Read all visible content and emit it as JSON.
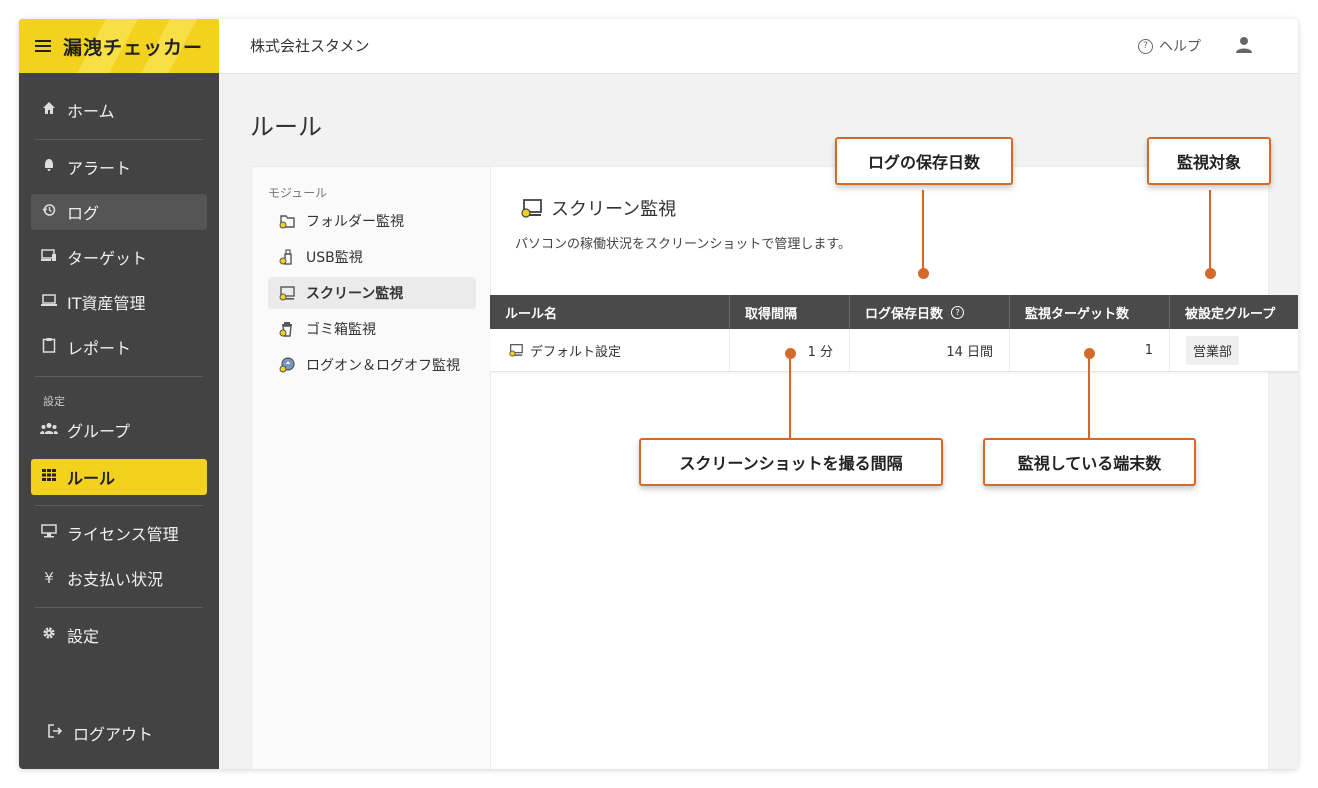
{
  "app": {
    "brand": "漏洩チェッカー",
    "company": "株式会社スタメン"
  },
  "header": {
    "help_label": "ヘルプ"
  },
  "sidebar": {
    "items": [
      {
        "label": "ホーム",
        "icon": "home-icon"
      },
      {
        "label": "アラート",
        "icon": "bell-icon"
      },
      {
        "label": "ログ",
        "icon": "history-icon"
      },
      {
        "label": "ターゲット",
        "icon": "devices-icon"
      },
      {
        "label": "IT資産管理",
        "icon": "laptop-icon"
      },
      {
        "label": "レポート",
        "icon": "clipboard-icon"
      }
    ],
    "section_label": "設定",
    "settings_items": [
      {
        "label": "グループ",
        "icon": "group-icon"
      },
      {
        "label": "ルール",
        "icon": "grid-icon"
      }
    ],
    "billing_items": [
      {
        "label": "ライセンス管理",
        "icon": "license-icon"
      },
      {
        "label": "お支払い状況",
        "icon": "yen-icon"
      }
    ],
    "config_label": "設定",
    "logout_label": "ログアウト"
  },
  "page": {
    "title": "ルール"
  },
  "modules": {
    "label": "モジュール",
    "items": [
      {
        "label": "フォルダー監視",
        "icon": "folder-watch-icon"
      },
      {
        "label": "USB監視",
        "icon": "usb-watch-icon"
      },
      {
        "label": "スクリーン監視",
        "icon": "screen-watch-icon",
        "selected": true
      },
      {
        "label": "ゴミ箱監視",
        "icon": "trash-watch-icon"
      },
      {
        "label": "ログオン＆ログオフ監視",
        "icon": "logon-watch-icon"
      }
    ]
  },
  "detail": {
    "title": "スクリーン監視",
    "description": "パソコンの稼働状況をスクリーンショットで管理します。",
    "table": {
      "columns": [
        "ルール名",
        "取得間隔",
        "ログ保存日数",
        "監視ターゲット数",
        "被設定グループ"
      ],
      "rows": [
        {
          "rule_name": "デフォルト設定",
          "interval": "1 分",
          "retention": "14 日間",
          "target_count": "1",
          "group": "営業部"
        }
      ]
    }
  },
  "callouts": {
    "log_retention": "ログの保存日数",
    "target": "監視対象",
    "interval": "スクリーンショットを撮る間隔",
    "terminal_count": "監視している端末数"
  },
  "colors": {
    "accent_yellow": "#f2d21c",
    "sidebar_bg": "#434343",
    "callout_orange": "#d4692c",
    "table_header": "#4a4a4a"
  }
}
